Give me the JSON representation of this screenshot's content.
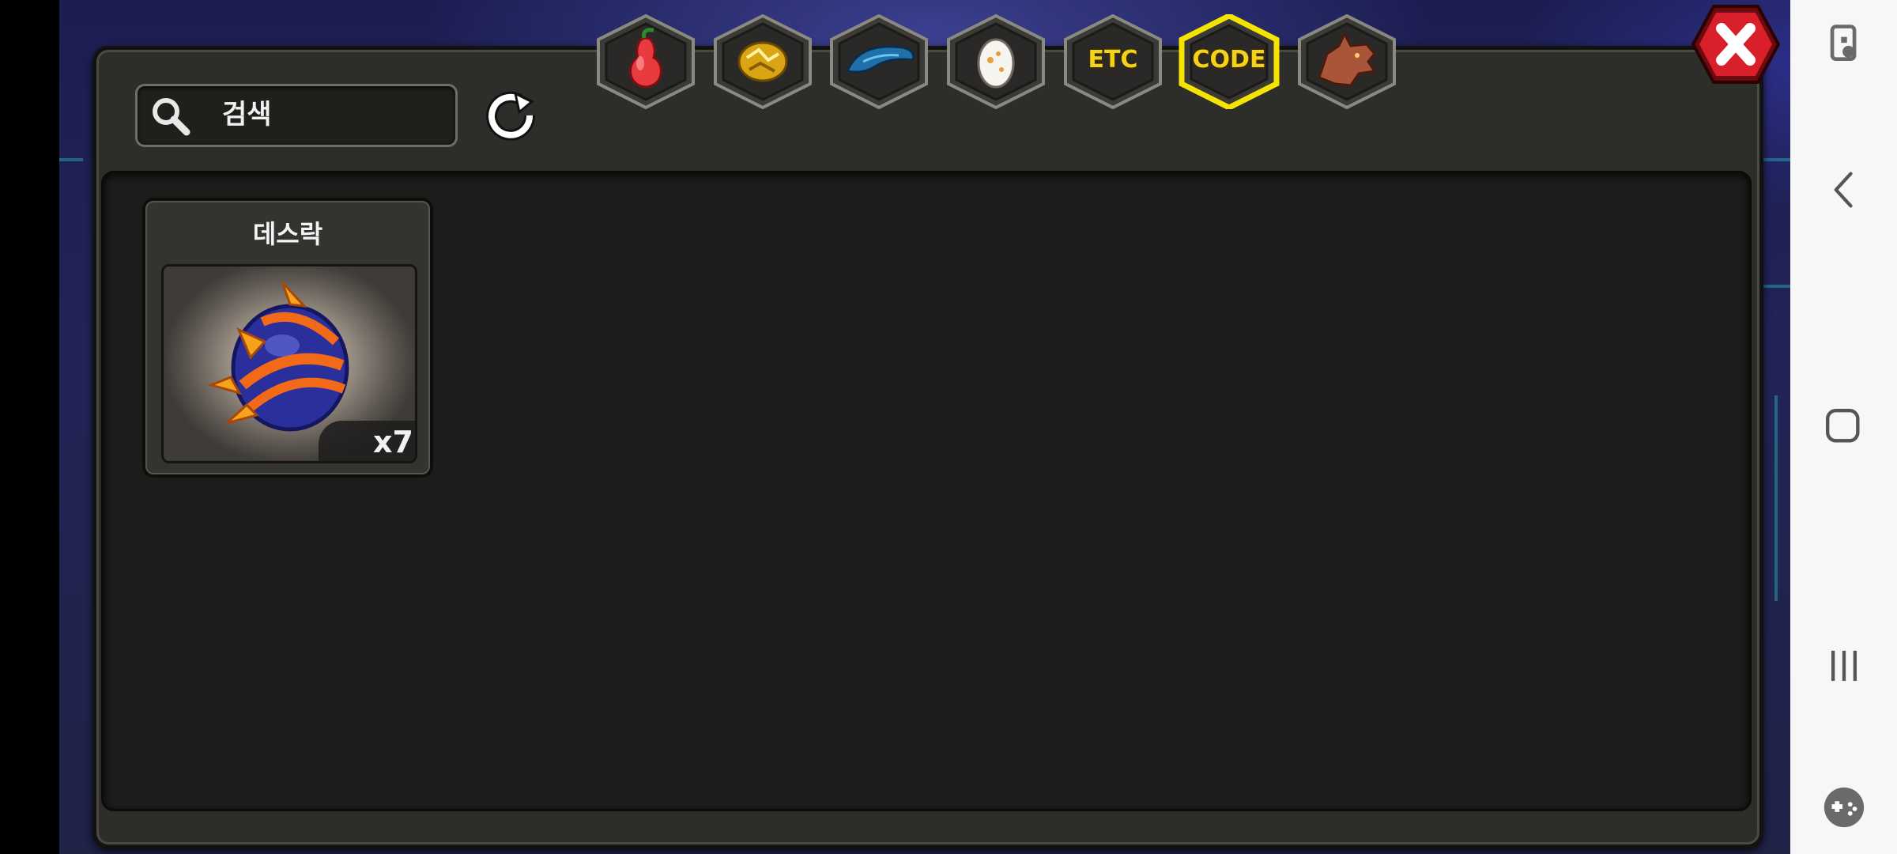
{
  "search": {
    "placeholder": "검색"
  },
  "tabs": [
    {
      "id": "fruit",
      "icon": "pear-fruit-icon",
      "label": ""
    },
    {
      "id": "gold",
      "icon": "gold-nugget-icon",
      "label": ""
    },
    {
      "id": "scale",
      "icon": "blue-scale-icon",
      "label": ""
    },
    {
      "id": "egg",
      "icon": "egg-icon",
      "label": ""
    },
    {
      "id": "etc",
      "icon": "",
      "label": "ETC"
    },
    {
      "id": "code",
      "icon": "",
      "label": "CODE",
      "selected": true
    },
    {
      "id": "dragon",
      "icon": "dragon-head-icon",
      "label": ""
    }
  ],
  "items": [
    {
      "name": "데스락",
      "count": "x7",
      "icon": "spiked-blue-orange-egg-icon"
    }
  ],
  "colors": {
    "selected_tab_glow": "#f5e400",
    "tab_text": "#f4d21c",
    "close_red": "#d9202a",
    "panel": "#2d2d2a",
    "list_bg": "#1c1c1b"
  },
  "navbar": {
    "icons": [
      "screen-touch-icon",
      "back-icon",
      "home-icon",
      "recents-icon",
      "game-tools-icon"
    ]
  }
}
